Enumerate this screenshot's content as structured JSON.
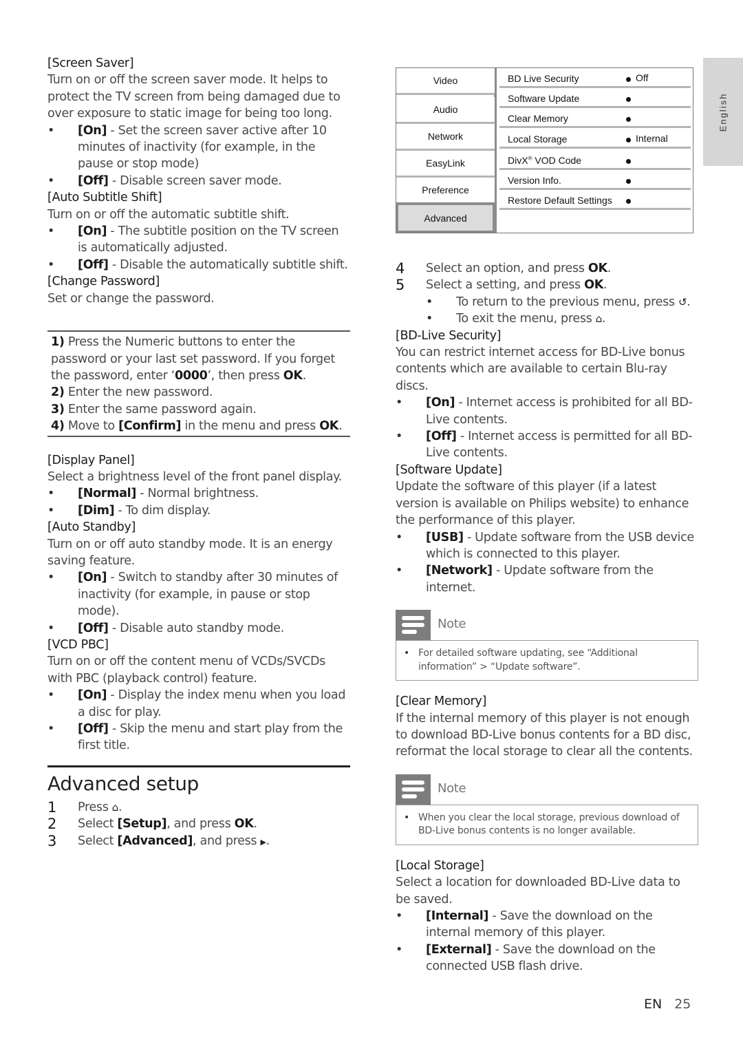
{
  "language_tab": "English",
  "left_column": {
    "screen_saver": {
      "heading": "[Screen Saver]",
      "desc": "Turn on or off the screen saver mode. It helps to protect the TV screen from being damaged due to over exposure to static image for being too long.",
      "on_label": "[On]",
      "on_text": " - Set the screen saver active after 10 minutes of inactivity (for example, in the pause or stop mode)",
      "off_label": "[Off]",
      "off_text": " - Disable screen saver mode."
    },
    "auto_subtitle_shift": {
      "heading": "[Auto Subtitle Shift]",
      "desc": "Turn on or off the automatic subtitle shift.",
      "on_label": "[On]",
      "on_text": " - The subtitle position on the TV screen is automatically adjusted.",
      "off_label": "[Off]",
      "off_text": " - Disable the automatically subtitle shift."
    },
    "change_password": {
      "heading": "[Change Password]",
      "desc": "Set or change the password.",
      "steps": [
        {
          "num": "1)",
          "pre": " Press the Numeric buttons to enter the password or your last set password. If you forget the password, enter ‘",
          "code": "0000",
          "mid": "’, then press ",
          "key": "OK",
          "post": "."
        },
        {
          "num": "2)",
          "text": " Enter the new password."
        },
        {
          "num": "3)",
          "text": " Enter the same password again."
        },
        {
          "num": "4)",
          "pre": " Move to ",
          "bold": "[Confirm]",
          "mid": " in the menu and press ",
          "key": "OK",
          "post": "."
        }
      ]
    },
    "display_panel": {
      "heading": "[Display Panel]",
      "desc": "Select a brightness level of the front panel display.",
      "normal_label": "[Normal]",
      "normal_text": " - Normal brightness.",
      "dim_label": "[Dim]",
      "dim_text": " - To dim display."
    },
    "auto_standby": {
      "heading": "[Auto Standby]",
      "desc": "Turn on or off auto standby mode. It is an energy saving feature.",
      "on_label": "[On]",
      "on_text": " - Switch to standby after 30 minutes of inactivity (for example, in pause or stop mode).",
      "off_label": "[Off]",
      "off_text": " - Disable auto standby mode."
    },
    "vcd_pbc": {
      "heading": "[VCD PBC]",
      "desc": "Turn on or off the content menu of VCDs/SVCDs with PBC (playback control) feature.",
      "on_label": "[On]",
      "on_text": " - Display the index menu when you load a disc for play.",
      "off_label": "[Off]",
      "off_text": " - Skip the menu and start play from the first title."
    },
    "advanced_setup": {
      "title": "Advanced setup",
      "steps": [
        {
          "num": "1",
          "pre": "Press ",
          "icon": "⌂",
          "post": "."
        },
        {
          "num": "2",
          "pre": "Select ",
          "bold": "[Setup]",
          "mid": ", and press ",
          "key": "OK",
          "post": "."
        },
        {
          "num": "3",
          "pre": "Select ",
          "bold": "[Advanced]",
          "mid": ", and press ",
          "icon": "▶",
          "post": "."
        }
      ]
    }
  },
  "menu": {
    "tabs": [
      "Video",
      "Audio",
      "Network",
      "EasyLink",
      "Preference",
      "Advanced"
    ],
    "active_tab": "Advanced",
    "rows": [
      {
        "label": "BD Live Security",
        "value": "Off"
      },
      {
        "label": "Software Update",
        "value": ""
      },
      {
        "label": "Clear Memory",
        "value": ""
      },
      {
        "label": "Local Storage",
        "value": "Internal"
      },
      {
        "label": "DivX",
        "sup": "®",
        "label_rest": " VOD Code",
        "value": ""
      },
      {
        "label": "Version Info.",
        "value": ""
      },
      {
        "label": "Restore Default Settings",
        "value": ""
      }
    ]
  },
  "right_column": {
    "steps": [
      {
        "num": "4",
        "pre": "Select an option, and press ",
        "key": "OK",
        "post": "."
      },
      {
        "num": "5",
        "pre": "Select a setting, and press ",
        "key": "OK",
        "post": "."
      }
    ],
    "sub_bullets": [
      {
        "text": "To return to the previous menu, press ",
        "icon": "↺",
        "post": "."
      },
      {
        "text": "To exit the menu, press ",
        "icon": "⌂",
        "post": "."
      }
    ],
    "bd_live_security": {
      "heading": "[BD-Live Security]",
      "desc": "You can restrict internet access for BD-Live bonus contents which are available to certain Blu-ray discs.",
      "on_label": "[On]",
      "on_text": " - Internet access is prohibited for all BD-Live contents.",
      "off_label": "[Off]",
      "off_text": " - Internet access is permitted for all BD-Live contents."
    },
    "software_update": {
      "heading": "[Software Update]",
      "desc": "Update the software of this player (if a latest version is available on Philips website) to enhance the performance of this player.",
      "usb_label": "[USB]",
      "usb_text": " - Update software from the USB device which is connected to this player.",
      "network_label": "[Network]",
      "network_text": " - Update software from the internet."
    },
    "note1": {
      "label": "Note",
      "text": "For detailed software updating, see “Additional information” > “Update software”."
    },
    "clear_memory": {
      "heading": "[Clear Memory]",
      "desc": "If the internal memory of this player is not enough to download BD-Live bonus contents for a BD disc, reformat the local storage to clear all the contents."
    },
    "note2": {
      "label": "Note",
      "text": "When you clear the local storage, previous download of BD-Live bonus contents is no longer available."
    },
    "local_storage": {
      "heading": "[Local Storage]",
      "desc": "Select a location for downloaded BD-Live data to be saved.",
      "internal_label": "[Internal]",
      "internal_text": " - Save the download on the internal memory of this player.",
      "external_label": "[External]",
      "external_text": " - Save the download on the connected USB flash drive."
    }
  },
  "footer": {
    "lang": "EN",
    "page": "25"
  }
}
